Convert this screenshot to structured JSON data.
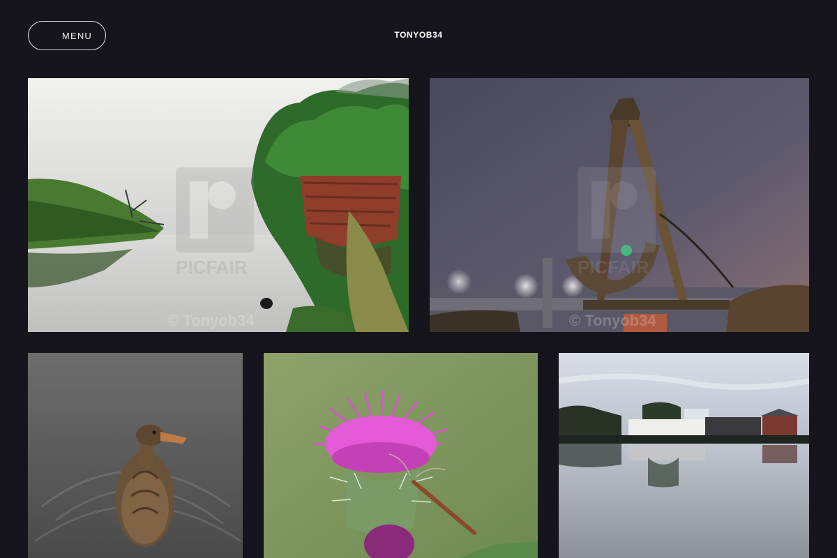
{
  "header": {
    "menu_label": "MENU",
    "site_title": "TONYOB34"
  },
  "watermark": {
    "brand": "PICFAIR",
    "credit": "© Tonyob34"
  },
  "photos": [
    {
      "subject": "misty river with rusting shipwreck and trees"
    },
    {
      "subject": "old anchor at harbour in fog at night"
    },
    {
      "subject": "mallard duck swimming on grey water"
    },
    {
      "subject": "purple thistle flower with dragonfly"
    },
    {
      "subject": "waterfront houses reflected in calm water"
    }
  ]
}
